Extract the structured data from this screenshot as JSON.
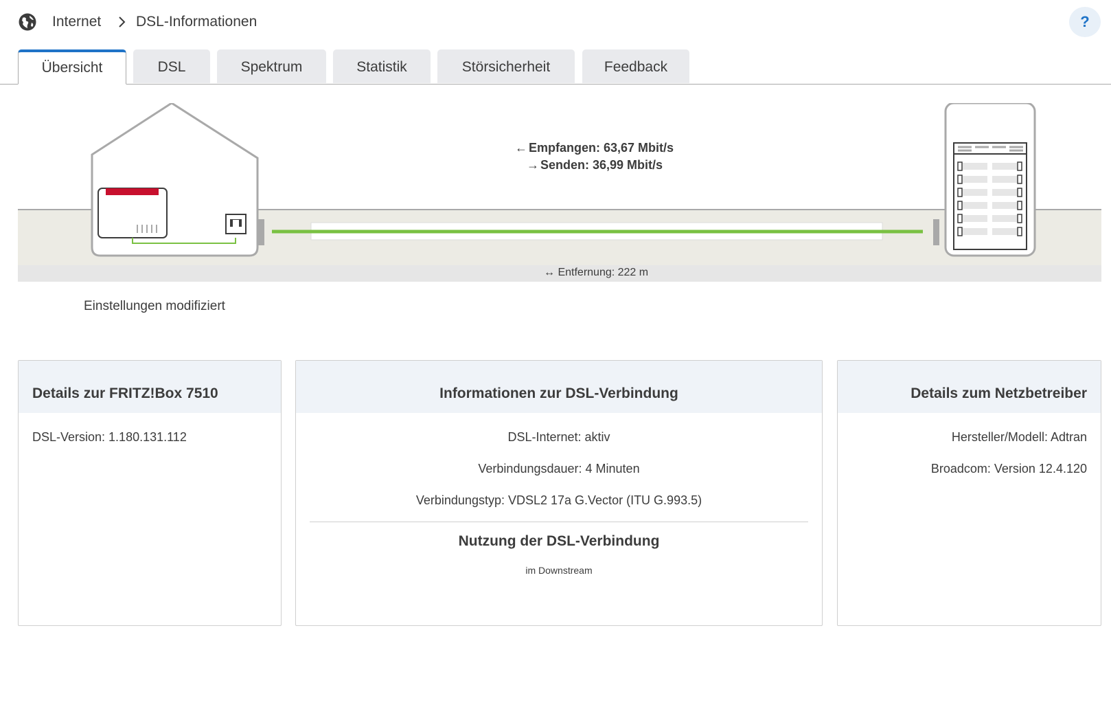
{
  "breadcrumb": {
    "root": "Internet",
    "current": "DSL-Informationen"
  },
  "help": {
    "label": "?"
  },
  "tabs": [
    {
      "label": "Übersicht",
      "active": true
    },
    {
      "label": "DSL",
      "active": false
    },
    {
      "label": "Spektrum",
      "active": false
    },
    {
      "label": "Statistik",
      "active": false
    },
    {
      "label": "Störsicherheit",
      "active": false
    },
    {
      "label": "Feedback",
      "active": false
    }
  ],
  "diagram": {
    "receive": "Empfangen: 63,67 Mbit/s",
    "send": "Senden: 36,99 Mbit/s",
    "distance": "Entfernung: 222 m",
    "status": "Einstellungen modifiziert"
  },
  "cards": {
    "fritzbox": {
      "title": "Details zur FRITZ!Box 7510",
      "lines": [
        "DSL-Version: 1.180.131.112"
      ]
    },
    "connection": {
      "title": "Informationen zur DSL-Verbindung",
      "lines": [
        "DSL-Internet: aktiv",
        "Verbindungsdauer: 4 Minuten",
        "Verbindungstyp: VDSL2 17a G.Vector (ITU G.993.5)"
      ],
      "usage_title": "Nutzung der DSL-Verbindung",
      "usage_note": "im Downstream"
    },
    "provider": {
      "title": "Details zum Netzbetreiber",
      "lines": [
        "Hersteller/Modell: Adtran",
        "Broadcom: Version 12.4.120"
      ]
    }
  },
  "colors": {
    "accent": "#1f73c7",
    "line_green": "#7ac143",
    "router_red": "#c8102e",
    "card_header": "#eff3f8",
    "tab_bg": "#e9eaed"
  },
  "icons": {
    "globe": "globe-icon",
    "chevron": "chevron-right-icon",
    "help": "help-icon"
  }
}
